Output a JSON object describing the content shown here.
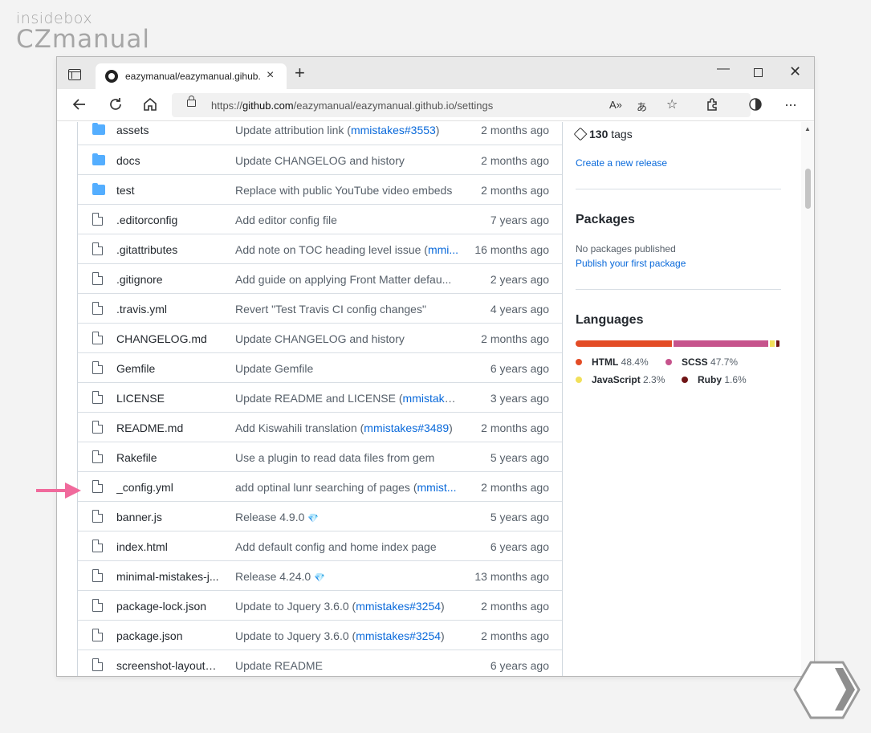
{
  "watermark": {
    "line1": "insidebox",
    "line2": "CZmanual"
  },
  "browser": {
    "tab_title": "eazymanual/eazymanual.gihub.io",
    "tab_close": "×",
    "new_tab": "+",
    "window_min": "—",
    "window_close": "✕",
    "url_prefix": "https://",
    "url_host": "github.com",
    "url_path": "/eazymanual/eazymanual.github.io/settings",
    "read_aloud": "A»",
    "translate": "あ",
    "favorite": "☆"
  },
  "files": [
    {
      "type": "folder",
      "name": "assets",
      "message": "Update attribution link (",
      "link": "mmistakes#3553",
      "suffix": ")",
      "age": "2 months ago"
    },
    {
      "type": "folder",
      "name": "docs",
      "message": "Update CHANGELOG and history",
      "link": "",
      "suffix": "",
      "age": "2 months ago"
    },
    {
      "type": "folder",
      "name": "test",
      "message": "Replace with public YouTube video embeds",
      "link": "",
      "suffix": "",
      "age": "2 months ago"
    },
    {
      "type": "file",
      "name": ".editorconfig",
      "message": "Add editor config file",
      "link": "",
      "suffix": "",
      "age": "7 years ago"
    },
    {
      "type": "file",
      "name": ".gitattributes",
      "message": "Add note on TOC heading level issue (",
      "link": "mmi...",
      "suffix": "",
      "age": "16 months ago"
    },
    {
      "type": "file",
      "name": ".gitignore",
      "message": "Add guide on applying Front Matter defau...",
      "link": "",
      "suffix": "",
      "age": "2 years ago"
    },
    {
      "type": "file",
      "name": ".travis.yml",
      "message": "Revert \"Test Travis CI config changes\"",
      "link": "",
      "suffix": "",
      "age": "4 years ago"
    },
    {
      "type": "file",
      "name": "CHANGELOG.md",
      "message": "Update CHANGELOG and history",
      "link": "",
      "suffix": "",
      "age": "2 months ago"
    },
    {
      "type": "file",
      "name": "Gemfile",
      "message": "Update Gemfile",
      "link": "",
      "suffix": "",
      "age": "6 years ago"
    },
    {
      "type": "file",
      "name": "LICENSE",
      "message": "Update README and LICENSE (",
      "link": "mmistakes...",
      "suffix": "",
      "age": "3 years ago"
    },
    {
      "type": "file",
      "name": "README.md",
      "message": "Add Kiswahili translation (",
      "link": "mmistakes#3489",
      "suffix": ")",
      "age": "2 months ago"
    },
    {
      "type": "file",
      "name": "Rakefile",
      "message": "Use a plugin to read data files from gem",
      "link": "",
      "suffix": "",
      "age": "5 years ago"
    },
    {
      "type": "file",
      "name": "_config.yml",
      "message": "add optinal lunr searching of pages (",
      "link": "mmist...",
      "suffix": "",
      "age": "2 months ago"
    },
    {
      "type": "file",
      "name": "banner.js",
      "message": "Release 4.9.0",
      "link": "",
      "suffix": "",
      "gem": "💎",
      "age": "5 years ago"
    },
    {
      "type": "file",
      "name": "index.html",
      "message": "Add default config and home index page",
      "link": "",
      "suffix": "",
      "age": "6 years ago"
    },
    {
      "type": "file",
      "name": "minimal-mistakes-j...",
      "message": "Release 4.24.0",
      "link": "",
      "suffix": "",
      "gem": "💎",
      "age": "13 months ago"
    },
    {
      "type": "file",
      "name": "package-lock.json",
      "message": "Update to Jquery 3.6.0 (",
      "link": "mmistakes#3254",
      "suffix": ")",
      "age": "2 months ago"
    },
    {
      "type": "file",
      "name": "package.json",
      "message": "Update to Jquery 3.6.0 (",
      "link": "mmistakes#3254",
      "suffix": ")",
      "age": "2 months ago"
    },
    {
      "type": "file",
      "name": "screenshot-layouts....",
      "message": "Update README",
      "link": "",
      "suffix": "",
      "age": "6 years ago"
    }
  ],
  "sidebar": {
    "tags_count": "130",
    "tags_label": "tags",
    "create_release": "Create a new release",
    "packages_title": "Packages",
    "no_packages": "No packages published",
    "publish_package": "Publish your first package",
    "languages_title": "Languages",
    "languages": [
      {
        "name": "HTML",
        "percent": "48.4%",
        "value": 48.4,
        "color": "#e34c26"
      },
      {
        "name": "SCSS",
        "percent": "47.7%",
        "value": 47.7,
        "color": "#c6538c"
      },
      {
        "name": "JavaScript",
        "percent": "2.3%",
        "value": 2.3,
        "color": "#f1e05a"
      },
      {
        "name": "Ruby",
        "percent": "1.6%",
        "value": 1.6,
        "color": "#701516"
      }
    ]
  }
}
